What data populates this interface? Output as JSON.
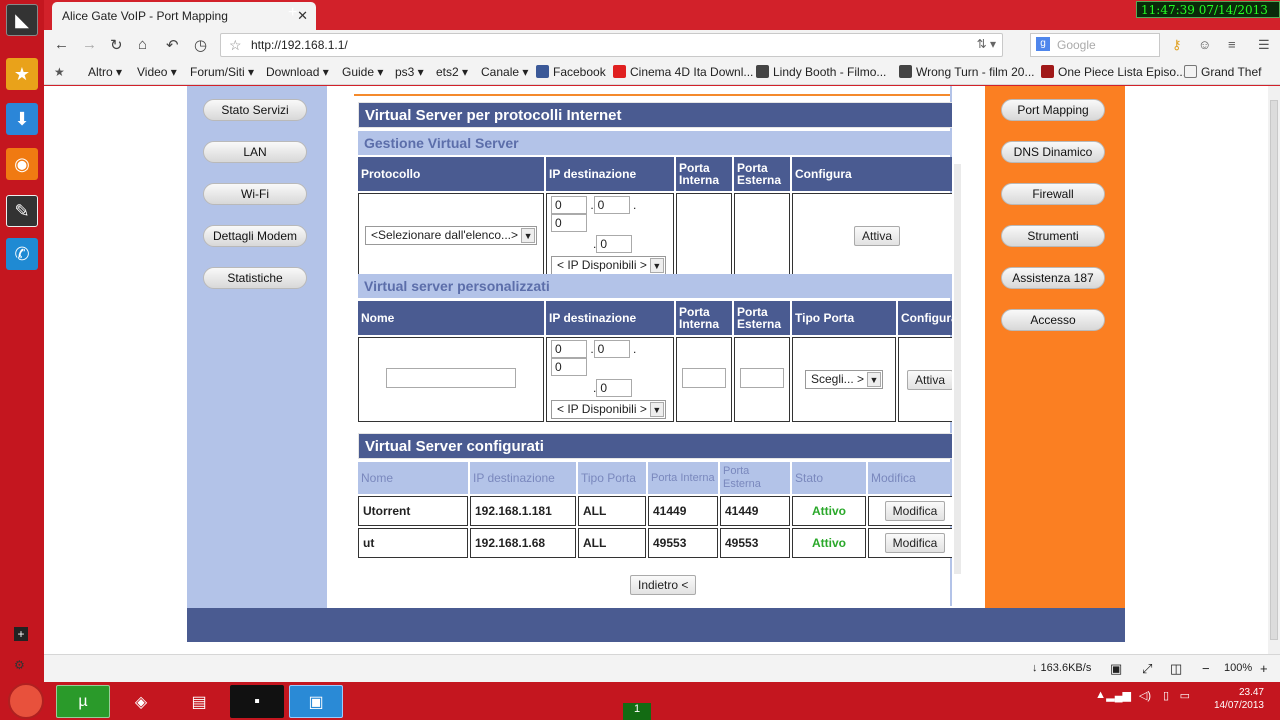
{
  "browser": {
    "tab_title": "Alice Gate VoIP - Port Mapping",
    "url": "http://192.168.1.1/",
    "search_placeholder": "Google",
    "clock": "11:47:39  07/14/2013",
    "bookmarks": [
      "Altro ▾",
      "Video ▾",
      "Forum/Siti ▾",
      "Download ▾",
      "Guide ▾",
      "ps3 ▾",
      "ets2 ▾",
      "Canale ▾",
      "Facebook",
      "Cinema 4D Ita Downl...",
      "Lindy Booth - Filmo...",
      "Wrong Turn - film 20...",
      "One Piece Lista Episo...",
      "Grand Thef"
    ],
    "status_speed": "↓ 163.6KB/s",
    "zoom": "100%"
  },
  "left_menu": [
    "Stato Servizi",
    "LAN",
    "Wi-Fi",
    "Dettagli Modem",
    "Statistiche"
  ],
  "right_menu": [
    "Port Mapping",
    "DNS Dinamico",
    "Firewall",
    "Strumenti",
    "Assistenza 187",
    "Accesso"
  ],
  "section1": {
    "title": "Virtual Server per protocolli Internet",
    "subtitle": "Gestione Virtual Server",
    "headers": [
      "Protocollo",
      "IP destinazione",
      "Porta Interna",
      "Porta Esterna",
      "Configura"
    ],
    "protocol_select": "<Selezionare dall'elenco...>",
    "ip": [
      "0",
      "0",
      "0",
      "0"
    ],
    "ip_select": "< IP Disponibili >",
    "button": "Attiva"
  },
  "section2": {
    "subtitle": "Virtual server personalizzati",
    "headers": [
      "Nome",
      "IP destinazione",
      "Porta Interna",
      "Porta Esterna",
      "Tipo Porta",
      "Configura"
    ],
    "ip": [
      "0",
      "0",
      "0",
      "0"
    ],
    "ip_select": "< IP Disponibili >",
    "tipo_select": "Scegli... >",
    "button": "Attiva"
  },
  "section3": {
    "title": "Virtual Server configurati",
    "headers": [
      "Nome",
      "IP destinazione",
      "Tipo Porta",
      "Porta Interna",
      "Porta Esterna",
      "Stato",
      "Modifica"
    ],
    "rows": [
      {
        "nome": "Utorrent",
        "ip": "192.168.1.181",
        "tipo": "ALL",
        "interna": "41449",
        "esterna": "41449",
        "stato": "Attivo",
        "modifica": "Modifica"
      },
      {
        "nome": "ut",
        "ip": "192.168.1.68",
        "tipo": "ALL",
        "interna": "49553",
        "esterna": "49553",
        "stato": "Attivo",
        "modifica": "Modifica"
      }
    ],
    "back_button": "Indietro <"
  },
  "taskbar": {
    "time": "23.47",
    "date": "14/07/2013",
    "badge": "1"
  }
}
